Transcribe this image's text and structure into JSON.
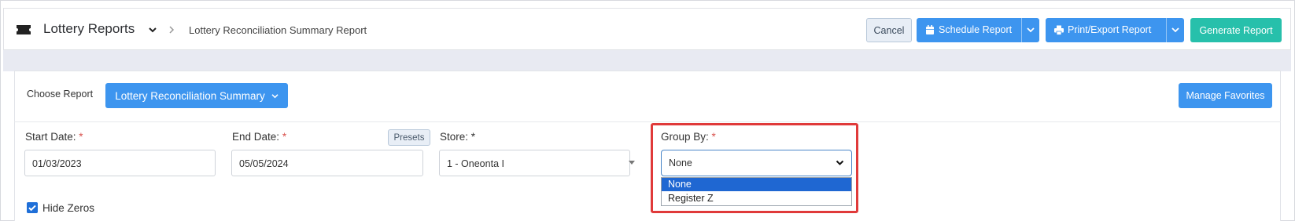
{
  "header": {
    "app_title": "Lottery Reports",
    "breadcrumb": "Lottery Reconciliation Summary Report",
    "buttons": {
      "cancel": "Cancel",
      "schedule": "Schedule Report",
      "print_export": "Print/Export Report",
      "generate": "Generate Report"
    }
  },
  "report_bar": {
    "choose_label": "Choose Report",
    "selected_report": "Lottery Reconciliation Summary",
    "manage_favorites": "Manage Favorites"
  },
  "filters": {
    "start_date": {
      "label": "Start Date:",
      "required_mark": "*",
      "value": "01/03/2023"
    },
    "end_date": {
      "label": "End Date:",
      "required_mark": "*",
      "value": "05/05/2024",
      "presets_label": "Presets"
    },
    "store": {
      "label": "Store: *",
      "value": "1 - Oneonta I"
    },
    "group_by": {
      "label": "Group By:",
      "required_mark": "*",
      "value": "None",
      "options": [
        "None",
        "Register Z"
      ],
      "highlighted_option_index": 0
    },
    "hide_zeros": {
      "label": "Hide Zeros",
      "checked": true
    }
  },
  "colors": {
    "primary": "#3d95ef",
    "generate": "#27c0ab",
    "highlight_border": "#e03a3a",
    "required": "#d9534f",
    "dropdown_selected": "#1f67d2"
  },
  "icons": {
    "app": "ticket-icon",
    "title_caret": "chevron-down-icon",
    "breadcrumb_separator": "chevron-right-icon",
    "schedule": "calendar-icon",
    "print": "printer-icon"
  }
}
